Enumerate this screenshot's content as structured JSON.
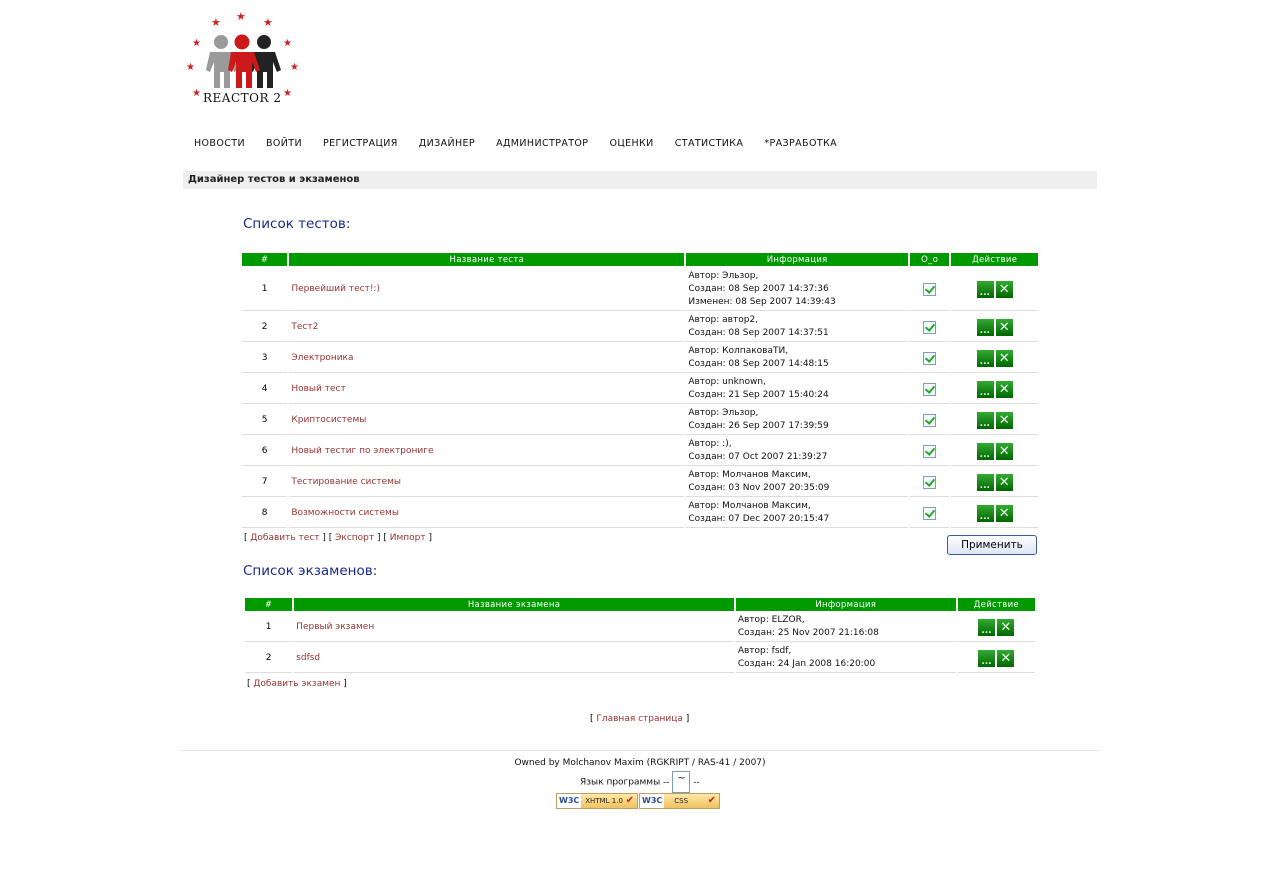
{
  "logo": {
    "text": "REACTOR 2"
  },
  "nav": [
    "НОВОСТИ",
    "ВОЙТИ",
    "РЕГИСТРАЦИЯ",
    "ДИЗАЙНЕР",
    "АДМИНИСТРАТОР",
    "ОЦЕНКИ",
    "СТАТИСТИКА",
    "*РАЗРАБОТКА"
  ],
  "page_title": "Дизайнер тестов и экзаменов",
  "tests": {
    "title": "Список тестов:",
    "headers": [
      "#",
      "Название теста",
      "Информация",
      "O_o",
      "Действие"
    ],
    "rows": [
      {
        "num": "1",
        "name": "Первейший тест!:)",
        "info": [
          "Автор: Эльзор,",
          "Создан: 08 Sep 2007 14:37:36",
          "Изменен: 08 Sep 2007 14:39:43"
        ],
        "checked": true
      },
      {
        "num": "2",
        "name": "Тест2",
        "info": [
          "Автор: автор2,",
          "Создан: 08 Sep 2007 14:37:51"
        ],
        "checked": true
      },
      {
        "num": "3",
        "name": "Электроника",
        "info": [
          "Автор: КолпаковаТИ,",
          "Создан: 08 Sep 2007 14:48:15"
        ],
        "checked": true
      },
      {
        "num": "4",
        "name": "Новый тест",
        "info": [
          "Автор: unknown,",
          "Создан: 21 Sep 2007 15:40:24"
        ],
        "checked": true
      },
      {
        "num": "5",
        "name": "Криптосистемы",
        "info": [
          "Автор: Эльзор,",
          "Создан: 26 Sep 2007 17:39:59"
        ],
        "checked": true
      },
      {
        "num": "6",
        "name": "Новый тестиг по электрониге",
        "info": [
          "Автор: :),",
          "Создан: 07 Oct 2007 21:39:27"
        ],
        "checked": true
      },
      {
        "num": "7",
        "name": "Тестирование системы",
        "info": [
          "Автор: Молчанов Максим,",
          "Создан: 03 Nov 2007 20:35:09"
        ],
        "checked": true
      },
      {
        "num": "8",
        "name": "Возможности системы",
        "info": [
          "Автор: Молчанов Максим,",
          "Создан: 07 Dec 2007 20:15:47"
        ],
        "checked": true
      }
    ],
    "links": [
      "Добавить тест",
      "Экспорт",
      "Импорт"
    ],
    "apply_label": "Применить"
  },
  "exams": {
    "title": "Список экзаменов:",
    "headers": [
      "#",
      "Название экзамена",
      "Информация",
      "Действие"
    ],
    "rows": [
      {
        "num": "1",
        "name": "Первый экзамен",
        "info": [
          "Автор: ELZOR,",
          "Создан: 25 Nov 2007 21:16:08"
        ]
      },
      {
        "num": "2",
        "name": "sdfsd",
        "info": [
          "Автор: fsdf,",
          "Создан: 24 Jan 2008 16:20:00"
        ]
      }
    ],
    "links": [
      "Добавить экзамен"
    ]
  },
  "main_link": "Главная страница",
  "footer": {
    "owned": "Owned by Molchanov Maxim (RGKRIPT / RAS-41 / 2007)",
    "lang_label": "Язык программы --",
    "lang_value": "~",
    "lang_suffix": "--",
    "badges": [
      {
        "w3c": "W3C",
        "label": "XHTML 1.0"
      },
      {
        "w3c": "W3C",
        "label": "CSS"
      }
    ]
  },
  "colors": {
    "header_green": "#009900",
    "link": "#993333",
    "section_title": "#1a2a8c"
  }
}
